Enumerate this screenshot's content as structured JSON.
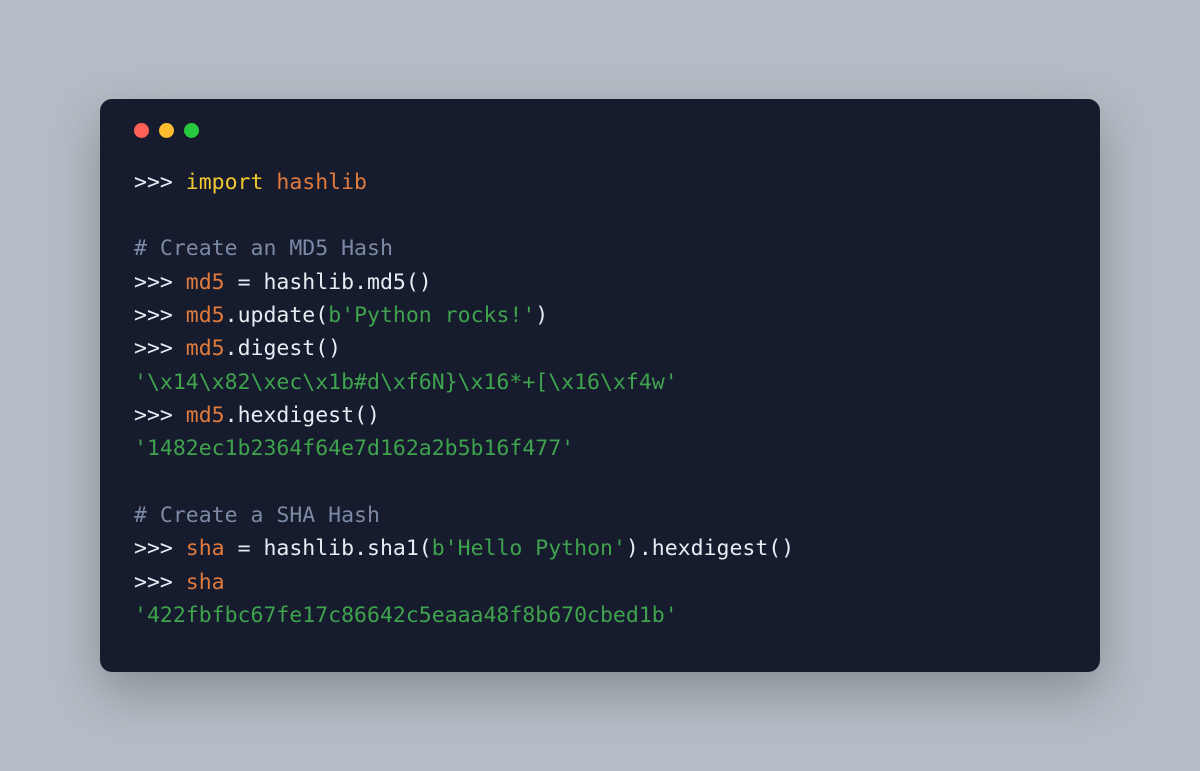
{
  "titlebar": {
    "close": "close",
    "minimize": "minimize",
    "zoom": "zoom"
  },
  "lines": {
    "l1_prompt": ">>> ",
    "l1_kw": "import ",
    "l1_mod": "hashlib",
    "l3_comment": "# Create an MD5 Hash",
    "l4_prompt": ">>> ",
    "l4_ident": "md5",
    "l4_rest": " = hashlib.md5()",
    "l5_prompt": ">>> ",
    "l5_ident": "md5",
    "l5_dot": ".update(",
    "l5_str": "b'Python rocks!'",
    "l5_close": ")",
    "l6_prompt": ">>> ",
    "l6_ident": "md5",
    "l6_rest": ".digest()",
    "l7_out": "'\\x14\\x82\\xec\\x1b#d\\xf6N}\\x16*+[\\x16\\xf4w'",
    "l8_prompt": ">>> ",
    "l8_ident": "md5",
    "l8_rest": ".hexdigest()",
    "l9_out": "'1482ec1b2364f64e7d162a2b5b16f477'",
    "l11_comment": "# Create a SHA Hash",
    "l12_prompt": ">>> ",
    "l12_ident": "sha",
    "l12_a": " = hashlib.sha1(",
    "l12_str": "b'Hello Python'",
    "l12_b": ").hexdigest()",
    "l13_prompt": ">>> ",
    "l13_ident": "sha",
    "l14_out": "'422fbfbc67fe17c86642c5eaaa48f8b670cbed1b'"
  }
}
